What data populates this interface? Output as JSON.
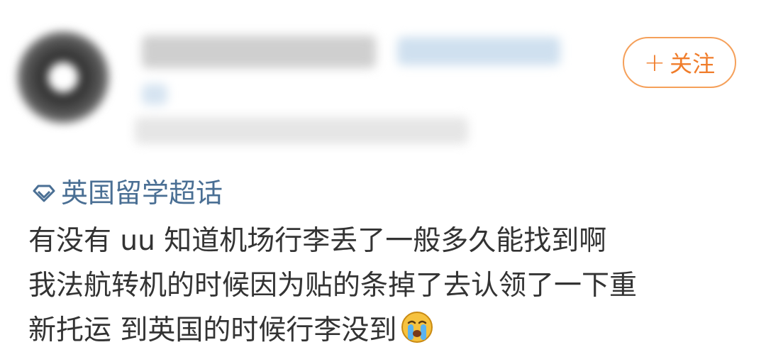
{
  "header": {
    "follow_button": {
      "plus": "+",
      "label": "关注"
    }
  },
  "topic": {
    "label": "英国留学超话"
  },
  "post": {
    "lines": [
      "有没有 uu 知道机场行李丢了一般多久能找到啊",
      "我法航转机的时候因为贴的条掉了去认领了一下重",
      "新托运 到英国的时候行李没到"
    ],
    "emoji": "crying-face-icon"
  },
  "colors": {
    "accent_orange": "#f07d2b",
    "follow_border": "#f5a05a",
    "topic_blue": "#4a6f94",
    "body_text": "#333333"
  }
}
